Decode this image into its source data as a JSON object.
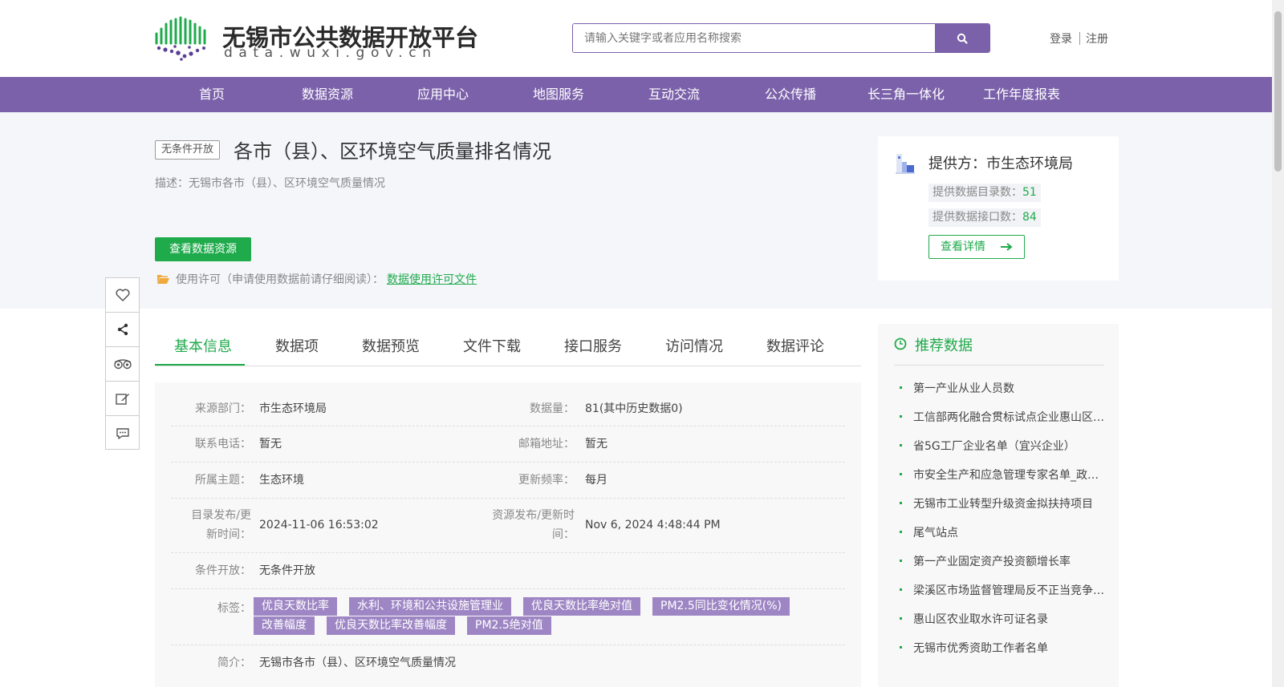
{
  "header": {
    "logo_title": "无锡市公共数据开放平台",
    "logo_sub": "data.wuxi.gov.cn",
    "search_placeholder": "请输入关键字或者应用名称搜索",
    "login": "登录",
    "register": "注册"
  },
  "nav": [
    "首页",
    "数据资源",
    "应用中心",
    "地图服务",
    "互动交流",
    "公众传播",
    "长三角一体化",
    "工作年度报表"
  ],
  "dataset": {
    "badge": "无条件开放",
    "title": "各市（县）、区环境空气质量排名情况",
    "description": "描述：无锡市各市（县）、区环境空气质量情况",
    "view_button": "查看数据资源",
    "license_text": "使用许可（申请使用数据前请仔细阅读）：",
    "license_link": "数据使用许可文件"
  },
  "provider": {
    "name": "提供方：市生态环境局",
    "catalog_label": "提供数据目录数：",
    "catalog_count": "51",
    "api_label": "提供数据接口数：",
    "api_count": "84",
    "detail_button": "查看详情"
  },
  "tabs": [
    "基本信息",
    "数据项",
    "数据预览",
    "文件下载",
    "接口服务",
    "访问情况",
    "数据评论"
  ],
  "info": {
    "source_label": "来源部门：",
    "source": "市生态环境局",
    "amount_label": "数据量：",
    "amount": "81(其中历史数据0)",
    "phone_label": "联系电话：",
    "phone": "暂无",
    "email_label": "邮箱地址：",
    "email": "暂无",
    "theme_label": "所属主题：",
    "theme": "生态环境",
    "freq_label": "更新频率：",
    "freq": "每月",
    "catalog_time_label_1": "目录发布/更",
    "catalog_time_label_2": "新时间：",
    "catalog_time": "2024-11-06 16:53:02",
    "resource_time_label_1": "资源发布/更新时",
    "resource_time_label_2": "间：",
    "resource_time": "Nov 6, 2024 4:48:44 PM",
    "condition_label": "条件开放：",
    "condition": "无条件开放",
    "tags_label": "标签：",
    "tags": [
      "优良天数比率",
      "水利、环境和公共设施管理业",
      "优良天数比率绝对值",
      "PM2.5同比变化情况(%)",
      "改善幅度",
      "优良天数比率改善幅度",
      "PM2.5绝对值"
    ],
    "summary_label": "简介：",
    "summary": "无锡市各市（县）、区环境空气质量情况"
  },
  "recommend": {
    "title": "推荐数据",
    "items": [
      "第一产业从业人员数",
      "工信部两化融合贯标试点企业惠山区名单",
      "省5G工厂企业名单（宜兴企业）",
      "市安全生产和应急管理专家名单_政务公开",
      "无锡市工业转型升级资金拟扶持项目",
      "尾气站点",
      "第一产业固定资产投资额增长率",
      "梁溪区市场监督管理局反不正当竞争案件",
      "惠山区农业取水许可证名录",
      "无锡市优秀资助工作者名单"
    ]
  },
  "colors": {
    "brand_purple": "#7b61aa",
    "accent_green": "#1faa4b",
    "tag_purple": "#9e86c4"
  }
}
